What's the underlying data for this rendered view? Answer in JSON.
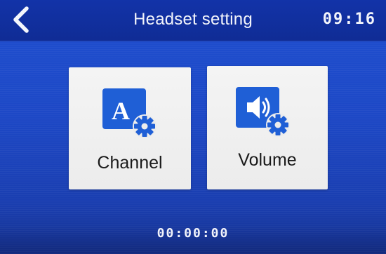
{
  "header": {
    "back_icon": "chevron-left-icon",
    "title": "Headset setting",
    "clock": "09:16"
  },
  "tiles": [
    {
      "label": "Channel",
      "icon": "channel-settings-icon",
      "icon_letter": "A"
    },
    {
      "label": "Volume",
      "icon": "volume-settings-icon"
    }
  ],
  "footer": {
    "timer": "00:00:00"
  },
  "colors": {
    "background": "#1d48c6",
    "header": "#1233a8",
    "tile": "#f0f0f0",
    "icon_blue": "#1f5fd6",
    "text_light": "#f2f4fb"
  }
}
